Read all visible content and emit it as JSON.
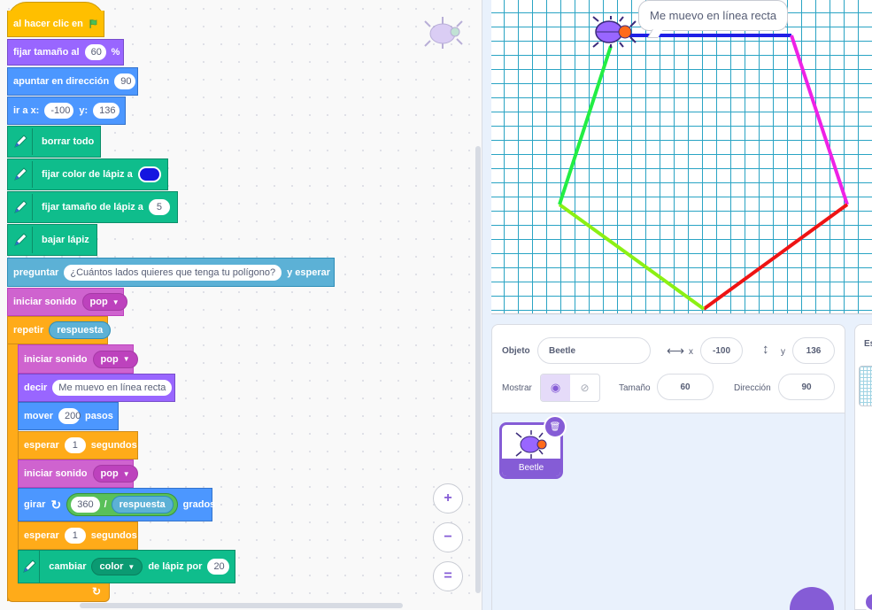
{
  "code": {
    "when_flag_clicked": "al hacer clic en",
    "set_size": {
      "label": "fijar tamaño al",
      "value": "60",
      "unit": "%"
    },
    "point_direction": {
      "label": "apuntar en dirección",
      "value": "90"
    },
    "go_to_xy": {
      "label": "ir a x:",
      "x": "-100",
      "y_label": "y:",
      "y": "136"
    },
    "erase_all": "borrar todo",
    "set_pen_color": "fijar color de lápiz a",
    "set_pen_size": {
      "label": "fijar tamaño de lápiz a",
      "value": "5"
    },
    "pen_down": "bajar lápiz",
    "ask": {
      "label": "preguntar",
      "question": "¿Cuántos lados quieres que tenga tu polígono?",
      "suffix": "y esperar"
    },
    "start_sound_1": {
      "label": "iniciar sonido",
      "sound": "pop"
    },
    "repeat": {
      "label": "repetir",
      "value": "respuesta"
    },
    "start_sound_2": {
      "label": "iniciar sonido",
      "sound": "pop"
    },
    "say": {
      "label": "decir",
      "text": "Me muevo en línea recta"
    },
    "move": {
      "label": "mover",
      "value": "200",
      "suffix": "pasos"
    },
    "wait_1": {
      "label": "esperar",
      "value": "1",
      "suffix": "segundos"
    },
    "start_sound_3": {
      "label": "iniciar sonido",
      "sound": "pop"
    },
    "turn": {
      "label": "girar",
      "num": "360",
      "op": "/",
      "divisor": "respuesta",
      "suffix": "grados"
    },
    "wait_2": {
      "label": "esperar",
      "value": "1",
      "suffix": "segundos"
    },
    "change_pen": {
      "label": "cambiar",
      "param": "color",
      "middle": "de lápiz por",
      "value": "20"
    },
    "zoom_in": "+",
    "zoom_out": "−",
    "zoom_reset": "="
  },
  "stage": {
    "speech_bubble": "Me muevo en línea recta",
    "pen_color_swatch": "#1515e0"
  },
  "sprite_info": {
    "sprite_label": "Objeto",
    "sprite_name": "Beetle",
    "x_label": "x",
    "x_value": "-100",
    "y_label": "y",
    "y_value": "136",
    "show_label": "Mostrar",
    "size_label": "Tamaño",
    "size_value": "60",
    "direction_label": "Dirección",
    "direction_value": "90"
  },
  "sprite_list": {
    "items": [
      {
        "name": "Beetle"
      }
    ]
  },
  "stage_pane": {
    "label": "Es"
  }
}
